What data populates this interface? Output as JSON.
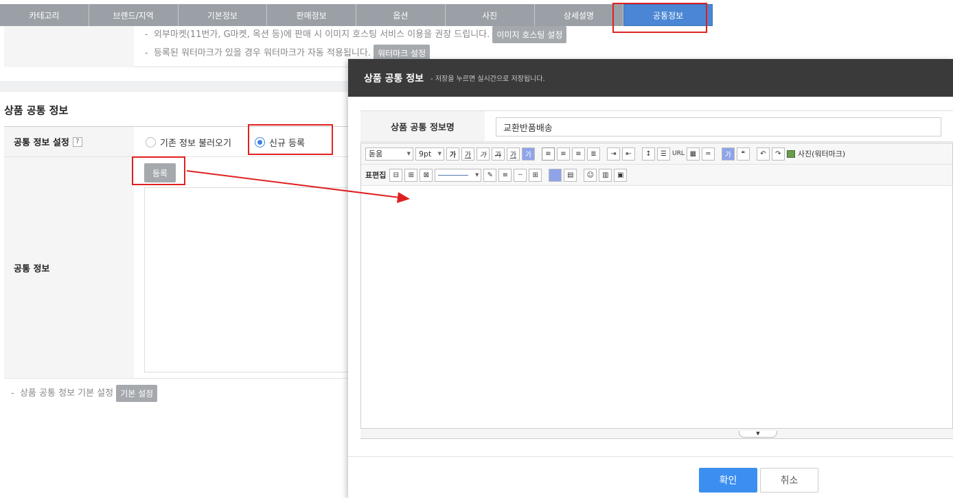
{
  "tabs": [
    {
      "label": "카테고리"
    },
    {
      "label": "브랜드/지역"
    },
    {
      "label": "기본정보"
    },
    {
      "label": "판매정보"
    },
    {
      "label": "옵션"
    },
    {
      "label": "사진"
    },
    {
      "label": "상세설명"
    },
    {
      "label": "공통정보",
      "active": true
    }
  ],
  "notice": {
    "line1": "외부마켓(11번가, G마켓, 옥션 등)에 판매 시 이미지 호스팅 서비스 이용을 권장 드립니다.",
    "line1_button": "이미지 호스팅 설정",
    "line2": "등록된 워터마크가 있을 경우 워터마크가 자동 적용됩니다.",
    "line2_button": "워터마크 설정"
  },
  "section": {
    "title": "상품 공통 정보",
    "setting_label": "공통 정보 설정",
    "help": "?",
    "radio_existing": "기존 정보 불러오기",
    "radio_new": "신규 등록",
    "register_button": "등록",
    "info_label": "공통 정보",
    "footer_note": "상품 공통 정보 기본 설정",
    "footer_button": "기본 설정"
  },
  "modal": {
    "title": "상품 공통 정보",
    "subtitle": "- 저장을 누르면 실시간으로 저장됩니다.",
    "name_label": "상품 공통 정보명",
    "name_value": "교환반품배송",
    "font_select": "돋움",
    "size_select": "9pt",
    "table_edit_label": "표편집",
    "url_label": "URL",
    "photo_label": "사진(워터마크)",
    "ok_button": "확인",
    "cancel_button": "취소"
  },
  "colors": {
    "tab_bg": "#9aa0a6",
    "tab_active": "#4a86d4",
    "highlight": "#e02020",
    "ok_button": "#3b8ff0",
    "modal_header": "#3a3a3a"
  }
}
